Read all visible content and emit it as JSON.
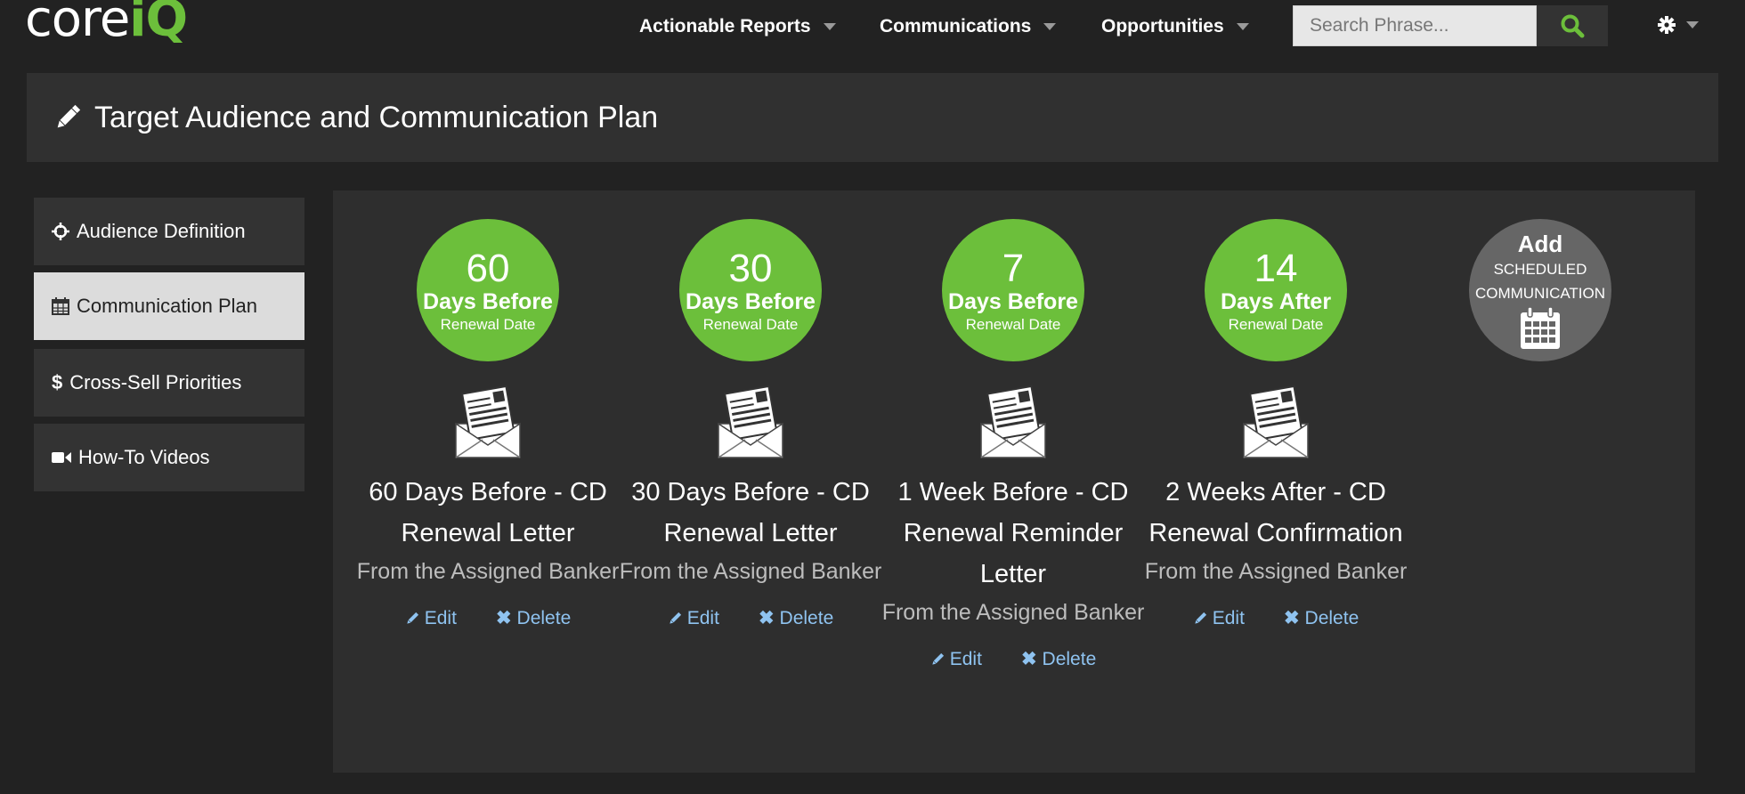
{
  "app": {
    "logo_core": "core",
    "logo_iq": "iQ"
  },
  "nav": {
    "items": [
      {
        "label": "Actionable Reports"
      },
      {
        "label": "Communications"
      },
      {
        "label": "Opportunities"
      }
    ],
    "search_placeholder": "Search Phrase...",
    "search_icon": "search-icon",
    "settings_icon": "gear-icon"
  },
  "page": {
    "title": "Target Audience and Communication Plan",
    "title_icon": "pencil-icon"
  },
  "sidebar": {
    "items": [
      {
        "label": "Audience Definition",
        "icon": "crosshair-icon",
        "active": false
      },
      {
        "label": "Communication Plan",
        "icon": "calendar-icon",
        "active": true
      },
      {
        "label": "Cross-Sell Priorities",
        "icon": "dollar-icon",
        "active": false
      },
      {
        "label": "How-To Videos",
        "icon": "video-camera-icon",
        "active": false
      }
    ]
  },
  "communications": [
    {
      "number": "60",
      "relation": "Days Before",
      "reference": "Renewal Date",
      "title": "60 Days Before - CD Renewal Letter",
      "from": "From the Assigned Banker",
      "edit_label": "Edit",
      "delete_label": "Delete"
    },
    {
      "number": "30",
      "relation": "Days Before",
      "reference": "Renewal Date",
      "title": "30 Days Before - CD Renewal Letter",
      "from": "From the Assigned Banker",
      "edit_label": "Edit",
      "delete_label": "Delete"
    },
    {
      "number": "7",
      "relation": "Days Before",
      "reference": "Renewal Date",
      "title": "1 Week Before - CD Renewal Reminder Letter",
      "from": "From the Assigned Banker",
      "edit_label": "Edit",
      "delete_label": "Delete"
    },
    {
      "number": "14",
      "relation": "Days After",
      "reference": "Renewal Date",
      "title": "2 Weeks After - CD Renewal Confirmation",
      "from": "From the Assigned Banker",
      "edit_label": "Edit",
      "delete_label": "Delete"
    }
  ],
  "add_button": {
    "add": "Add",
    "line1": "SCHEDULED",
    "line2": "COMMUNICATION",
    "icon": "calendar-icon"
  },
  "colors": {
    "accent_green": "#6cbf3b",
    "link_blue": "#8fc3f0",
    "add_gray": "#666666"
  }
}
